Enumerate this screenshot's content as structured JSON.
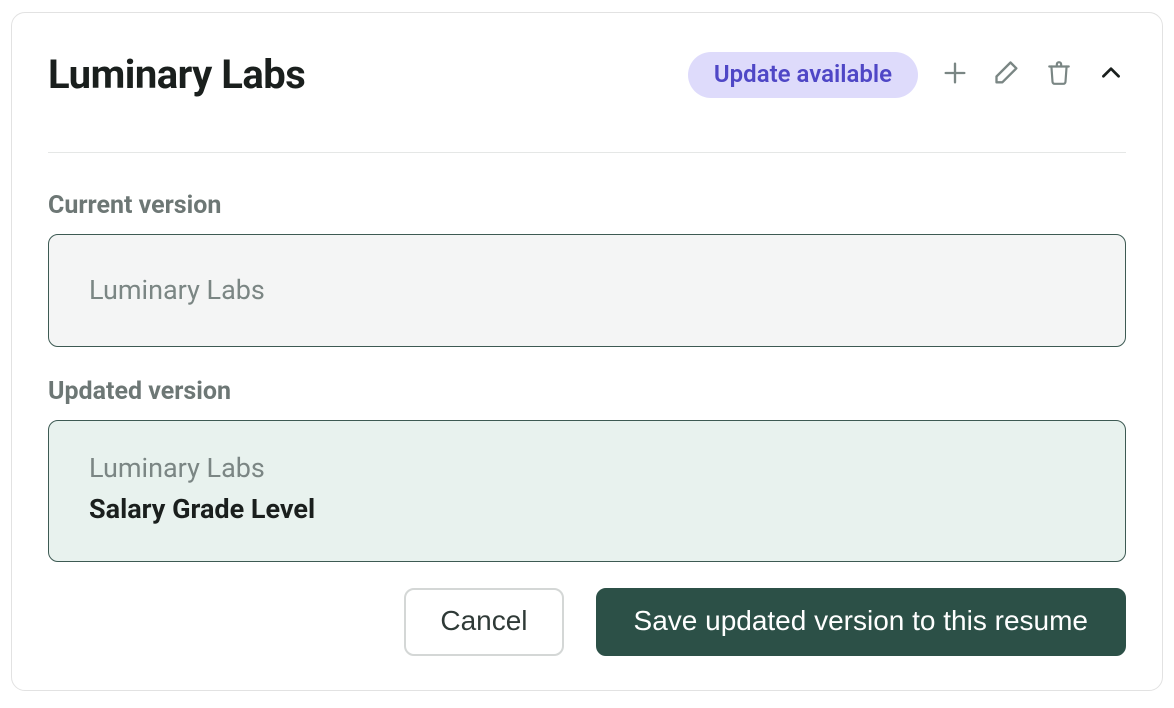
{
  "header": {
    "title": "Luminary Labs",
    "badge": "Update available"
  },
  "sections": {
    "current_label": "Current version",
    "current_value": "Luminary Labs",
    "updated_label": "Updated version",
    "updated_line1": "Luminary Labs",
    "updated_line2": "Salary Grade Level"
  },
  "buttons": {
    "cancel": "Cancel",
    "save": "Save updated version to this resume"
  }
}
